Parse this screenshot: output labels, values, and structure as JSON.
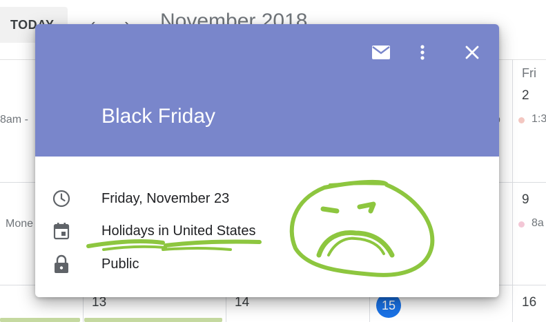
{
  "toolbar": {
    "today_label": "TODAY",
    "prev_icon": "chevron-left-icon",
    "next_icon": "chevron-right-icon",
    "month_title": "November 2018"
  },
  "calendar": {
    "weekday_fri": "Fri",
    "day_2": "2",
    "day_9": "9",
    "day_13": "13",
    "day_14": "14",
    "day_15": "15",
    "day_16": "16",
    "event_row1_left": "8am -",
    "event_row1_right": "p",
    "event_row1_fri": "1:3",
    "event_row2_left": "Mone",
    "event_row2_fri": "8a",
    "today_color": "#1a73e8"
  },
  "dialog": {
    "header_color": "#7986cb",
    "mail_icon": "mail-icon",
    "more_icon": "more-vert-icon",
    "close_icon": "close-icon",
    "title": "Black Friday",
    "date_text": "Friday, November 23",
    "calendar_text": "Holidays in United States",
    "visibility_text": "Public",
    "date_icon": "clock-icon",
    "calendar_icon": "calendar-icon",
    "visibility_icon": "lock-icon"
  },
  "annotation": {
    "color": "#8dc63f",
    "description_icon": "frown-doodle-icon"
  }
}
